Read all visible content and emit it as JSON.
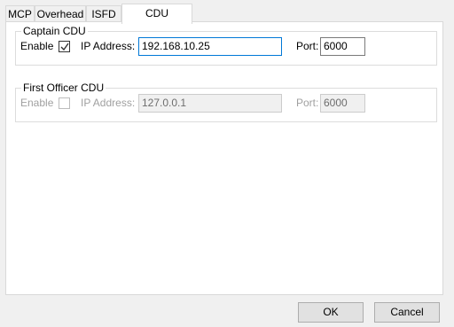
{
  "tabs": [
    {
      "label": "MCP"
    },
    {
      "label": "Overhead"
    },
    {
      "label": "ISFD"
    },
    {
      "label": "CDU"
    }
  ],
  "captain": {
    "legend": "Captain CDU",
    "enable_label": "Enable",
    "enabled": true,
    "ip_label": "IP Address:",
    "ip_value": "192.168.10.25",
    "port_label": "Port:",
    "port_value": "6000"
  },
  "first_officer": {
    "legend": "First Officer CDU",
    "enable_label": "Enable",
    "enabled": false,
    "ip_label": "IP Address:",
    "ip_value": "127.0.0.1",
    "port_label": "Port:",
    "port_value": "6000"
  },
  "buttons": {
    "ok": "OK",
    "cancel": "Cancel"
  },
  "colors": {
    "focus_border": "#0078d7",
    "panel_bg": "#ffffff",
    "window_bg": "#f0f0f0"
  }
}
